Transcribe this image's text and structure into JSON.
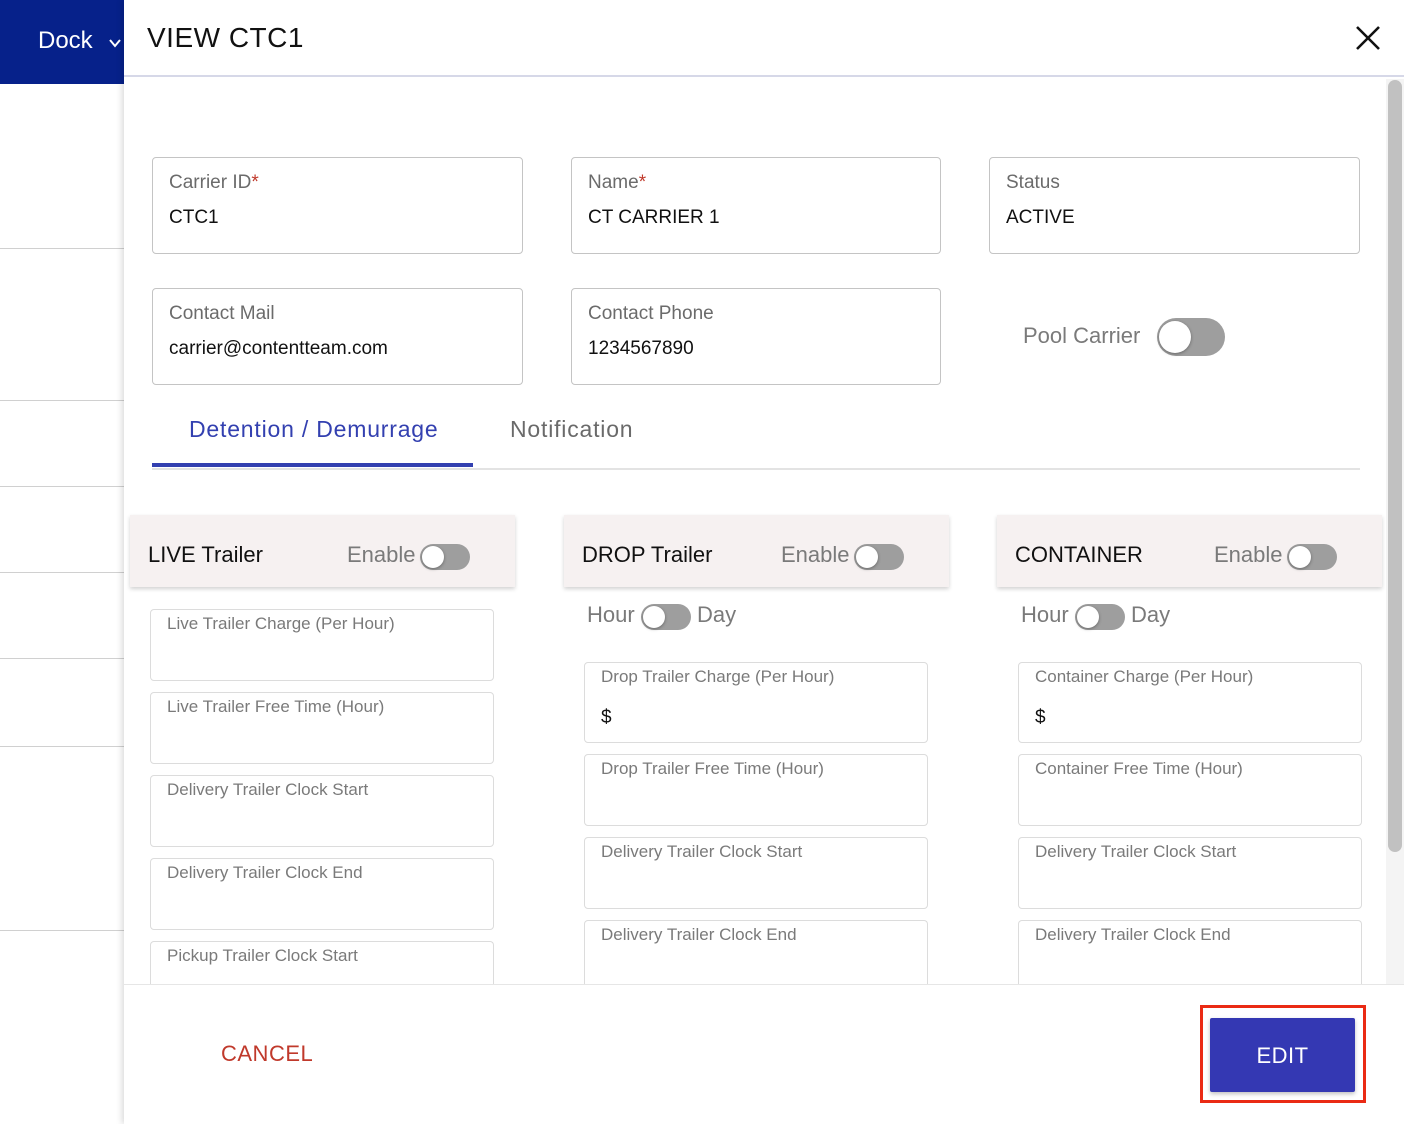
{
  "background": {
    "nav_label": "Dock",
    "nav_icon": "chevron-down-icon"
  },
  "modal": {
    "title": "VIEW CTC1",
    "close_icon": "close-icon"
  },
  "fields": {
    "carrier_id": {
      "label": "Carrier ID",
      "required_mark": "*",
      "value": "CTC1"
    },
    "name": {
      "label": "Name",
      "required_mark": "*",
      "value": "CT CARRIER 1"
    },
    "status": {
      "label": "Status",
      "value": "ACTIVE"
    },
    "contact_mail": {
      "label": "Contact Mail",
      "value": "carrier@contentteam.com"
    },
    "contact_phone": {
      "label": "Contact Phone",
      "value": "1234567890"
    },
    "pool_carrier": {
      "label": "Pool Carrier",
      "enabled": false
    }
  },
  "tabs": [
    {
      "label": "Detention / Demurrage",
      "active": true
    },
    {
      "label": "Notification",
      "active": false
    }
  ],
  "sections": {
    "live": {
      "title": "LIVE Trailer",
      "enable_label": "Enable",
      "enabled": false,
      "fields": [
        {
          "label": "Live Trailer Charge (Per Hour)",
          "value": ""
        },
        {
          "label": "Live Trailer Free Time (Hour)",
          "value": ""
        },
        {
          "label": "Delivery Trailer Clock Start",
          "value": ""
        },
        {
          "label": "Delivery Trailer Clock End",
          "value": ""
        },
        {
          "label": "Pickup Trailer Clock Start",
          "value": ""
        }
      ]
    },
    "drop": {
      "title": "DROP Trailer",
      "enable_label": "Enable",
      "enabled": false,
      "hour_label": "Hour",
      "day_label": "Day",
      "fields": [
        {
          "label": "Drop Trailer Charge (Per Hour)",
          "value": "$"
        },
        {
          "label": "Drop Trailer Free Time (Hour)",
          "value": ""
        },
        {
          "label": "Delivery Trailer Clock Start",
          "value": ""
        },
        {
          "label": "Delivery Trailer Clock End",
          "value": ""
        }
      ]
    },
    "container": {
      "title": "CONTAINER",
      "enable_label": "Enable",
      "enabled": false,
      "hour_label": "Hour",
      "day_label": "Day",
      "fields": [
        {
          "label": "Container Charge (Per Hour)",
          "value": "$"
        },
        {
          "label": "Container Free Time (Hour)",
          "value": ""
        },
        {
          "label": "Delivery Trailer Clock Start",
          "value": ""
        },
        {
          "label": "Delivery Trailer Clock End",
          "value": ""
        }
      ]
    }
  },
  "footer": {
    "cancel_label": "CANCEL",
    "edit_label": "EDIT"
  },
  "colors": {
    "nav_bg": "#06218a",
    "accent": "#3340b0",
    "edit_button": "#3438b3",
    "cancel_text": "#c0392b",
    "highlight_border": "#ea2a14"
  }
}
